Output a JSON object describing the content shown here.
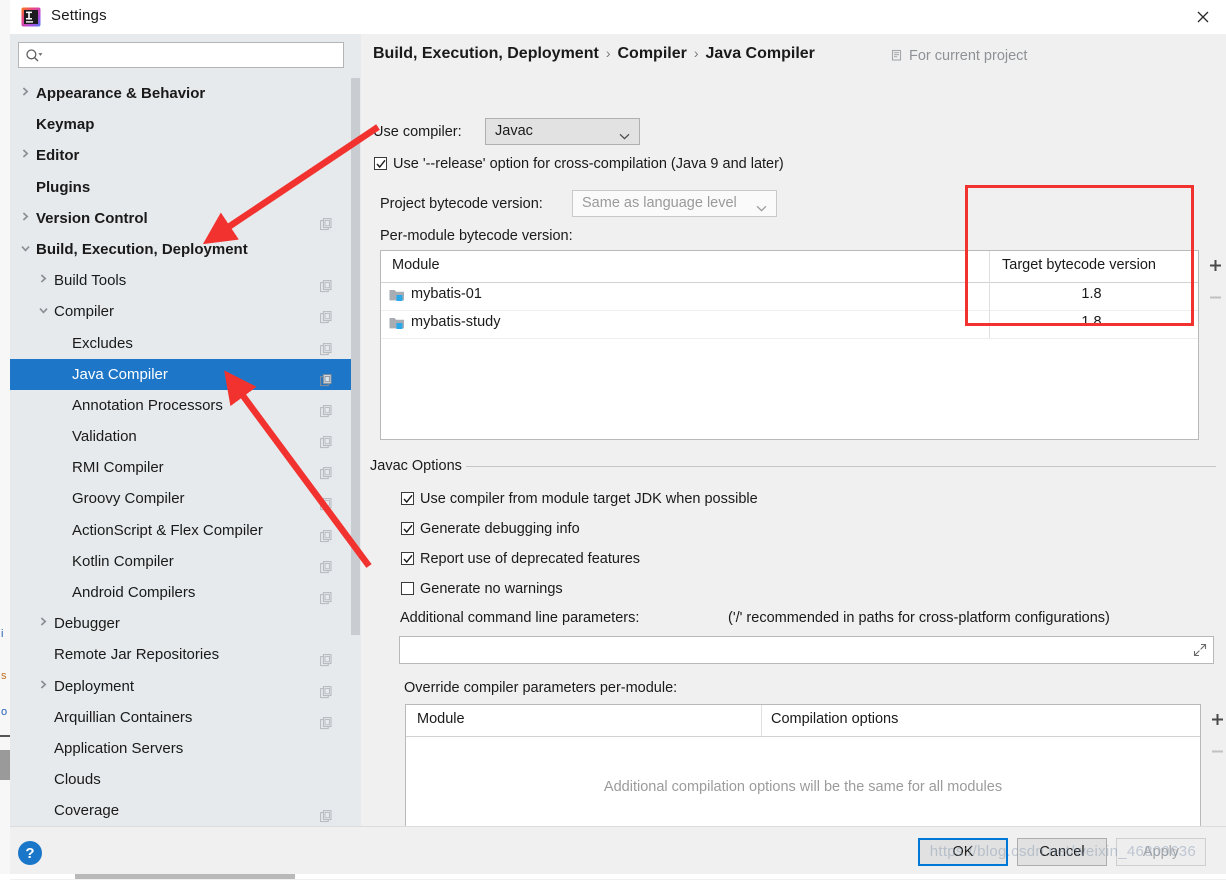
{
  "window": {
    "title": "Settings",
    "logo_icon": "intellij-idea-logo",
    "close_icon": "close-icon"
  },
  "search": {
    "placeholder": "",
    "value": "",
    "icon": "search-icon"
  },
  "sidebar": {
    "items": [
      {
        "label": "Appearance & Behavior",
        "indent": 10,
        "twisty": "chevron-right",
        "bold": true,
        "copy": false,
        "selected": false
      },
      {
        "label": "Keymap",
        "indent": 10,
        "twisty": "",
        "bold": true,
        "copy": false,
        "selected": false
      },
      {
        "label": "Editor",
        "indent": 10,
        "twisty": "chevron-right",
        "bold": true,
        "copy": false,
        "selected": false
      },
      {
        "label": "Plugins",
        "indent": 10,
        "twisty": "",
        "bold": true,
        "copy": false,
        "selected": false
      },
      {
        "label": "Version Control",
        "indent": 10,
        "twisty": "chevron-right",
        "bold": true,
        "copy": true,
        "selected": false
      },
      {
        "label": "Build, Execution, Deployment",
        "indent": 10,
        "twisty": "chevron-down",
        "bold": true,
        "copy": false,
        "selected": false
      },
      {
        "label": "Build Tools",
        "indent": 28,
        "twisty": "chevron-right",
        "bold": false,
        "copy": true,
        "selected": false
      },
      {
        "label": "Compiler",
        "indent": 28,
        "twisty": "chevron-down",
        "bold": false,
        "copy": true,
        "selected": false
      },
      {
        "label": "Excludes",
        "indent": 46,
        "twisty": "",
        "bold": false,
        "copy": true,
        "selected": false
      },
      {
        "label": "Java Compiler",
        "indent": 46,
        "twisty": "",
        "bold": false,
        "copy": true,
        "selected": true
      },
      {
        "label": "Annotation Processors",
        "indent": 46,
        "twisty": "",
        "bold": false,
        "copy": true,
        "selected": false
      },
      {
        "label": "Validation",
        "indent": 46,
        "twisty": "",
        "bold": false,
        "copy": true,
        "selected": false
      },
      {
        "label": "RMI Compiler",
        "indent": 46,
        "twisty": "",
        "bold": false,
        "copy": true,
        "selected": false
      },
      {
        "label": "Groovy Compiler",
        "indent": 46,
        "twisty": "",
        "bold": false,
        "copy": true,
        "selected": false
      },
      {
        "label": "ActionScript & Flex Compiler",
        "indent": 46,
        "twisty": "",
        "bold": false,
        "copy": true,
        "selected": false
      },
      {
        "label": "Kotlin Compiler",
        "indent": 46,
        "twisty": "",
        "bold": false,
        "copy": true,
        "selected": false
      },
      {
        "label": "Android Compilers",
        "indent": 46,
        "twisty": "",
        "bold": false,
        "copy": true,
        "selected": false
      },
      {
        "label": "Debugger",
        "indent": 28,
        "twisty": "chevron-right",
        "bold": false,
        "copy": false,
        "selected": false
      },
      {
        "label": "Remote Jar Repositories",
        "indent": 28,
        "twisty": "",
        "bold": false,
        "copy": true,
        "selected": false
      },
      {
        "label": "Deployment",
        "indent": 28,
        "twisty": "chevron-right",
        "bold": false,
        "copy": true,
        "selected": false
      },
      {
        "label": "Arquillian Containers",
        "indent": 28,
        "twisty": "",
        "bold": false,
        "copy": true,
        "selected": false
      },
      {
        "label": "Application Servers",
        "indent": 28,
        "twisty": "",
        "bold": false,
        "copy": false,
        "selected": false
      },
      {
        "label": "Clouds",
        "indent": 28,
        "twisty": "",
        "bold": false,
        "copy": false,
        "selected": false
      },
      {
        "label": "Coverage",
        "indent": 28,
        "twisty": "",
        "bold": false,
        "copy": true,
        "selected": false
      }
    ]
  },
  "content": {
    "breadcrumb": [
      "Build, Execution, Deployment",
      "Compiler",
      "Java Compiler"
    ],
    "breadcrumb_separator": "›",
    "for_current_project": "For current project",
    "use_compiler_label": "Use compiler:",
    "use_compiler_value": "Javac",
    "release_option_label": "Use '--release' option for cross-compilation (Java 9 and later)",
    "release_option_checked": true,
    "project_bytecode_label": "Project bytecode version:",
    "project_bytecode_value": "Same as language level",
    "per_module_label": "Per-module bytecode version:",
    "bytecode_table": {
      "columns": [
        "Module",
        "Target bytecode version"
      ],
      "rows": [
        {
          "module": "mybatis-01",
          "target": "1.8"
        },
        {
          "module": "mybatis-study",
          "target": "1.8"
        }
      ],
      "add_label": "+",
      "remove_label": "−"
    },
    "javac_options": {
      "title": "Javac Options",
      "checkboxes": [
        {
          "label": "Use compiler from module target JDK when possible",
          "checked": true
        },
        {
          "label": "Generate debugging info",
          "checked": true
        },
        {
          "label": "Report use of deprecated features",
          "checked": true
        },
        {
          "label": "Generate no warnings",
          "checked": false
        }
      ],
      "additional_params_label": "Additional command line parameters:",
      "additional_params_hint": "('/' recommended in paths for cross-platform configurations)",
      "additional_params_value": ""
    },
    "override_section": {
      "label": "Override compiler parameters per-module:",
      "columns": [
        "Module",
        "Compilation options"
      ],
      "empty_message": "Additional compilation options will be the same for all modules",
      "add_label": "+",
      "remove_label": "−"
    }
  },
  "footer": {
    "help_label": "?",
    "ok_label": "OK",
    "cancel_label": "Cancel",
    "apply_label": "Apply"
  },
  "watermark": "https://blog.csdn.net/weixin_46809636",
  "colors": {
    "accent": "#1d76c8",
    "annotation": "#f2322e",
    "sidebar_bg": "#e6eaed",
    "content_bg": "#f0f0f0"
  }
}
